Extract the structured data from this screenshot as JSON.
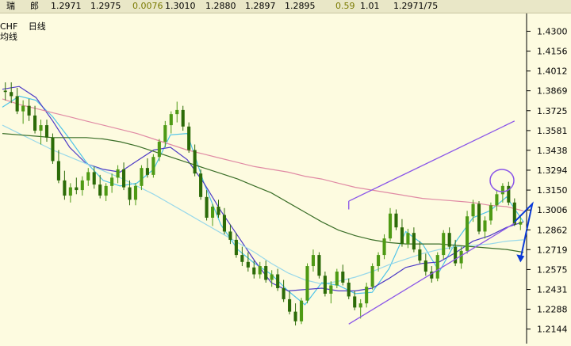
{
  "quote_bar": {
    "symbol_fragment": "瑞",
    "label": "郎",
    "values": [
      "1.2971",
      "1.2975",
      "0.0076",
      "1.3010",
      "1.2880",
      "1.2897",
      "1.2895",
      "0.59",
      "1.01",
      "1.2971/75"
    ]
  },
  "chart_header": {
    "pair_fragment": "CHF",
    "period": "日线",
    "indicator_fragment": "均线"
  },
  "colors": {
    "background": "#fdfbe0",
    "up_candle": "#4e9a14",
    "down_candle": "#2c6b08",
    "ma_fast": "#4fc4e8",
    "ma_mid": "#4d3bc6",
    "ma_slow_dark": "#3a6e28",
    "ma_slow_pink": "#e08aa4",
    "ma_slow_light": "#98d8ea",
    "channel": "#8a55e8",
    "forecast_arrow": "#0a3ad8",
    "highlight": "#7a7a00"
  },
  "chart_data": {
    "type": "candlestick",
    "title": "",
    "y_axis_side": "right",
    "ylim": [
      1.205,
      1.44
    ],
    "y_ticks": [
      "1.4300",
      "1.4156",
      "1.4012",
      "1.3869",
      "1.3725",
      "1.3581",
      "1.3438",
      "1.3294",
      "1.3150",
      "1.3006",
      "1.2862",
      "1.2719",
      "1.2575",
      "1.2431",
      "1.2288",
      "1.2144"
    ],
    "grid": false,
    "candles": [
      [
        1.387,
        1.393,
        1.38,
        1.386
      ],
      [
        1.386,
        1.393,
        1.378,
        1.383
      ],
      [
        1.383,
        1.389,
        1.37,
        1.372
      ],
      [
        1.372,
        1.38,
        1.363,
        1.376
      ],
      [
        1.376,
        1.381,
        1.365,
        1.369
      ],
      [
        1.369,
        1.376,
        1.356,
        1.358
      ],
      [
        1.358,
        1.366,
        1.348,
        1.362
      ],
      [
        1.362,
        1.366,
        1.35,
        1.353
      ],
      [
        1.353,
        1.356,
        1.334,
        1.336
      ],
      [
        1.336,
        1.344,
        1.32,
        1.322
      ],
      [
        1.322,
        1.329,
        1.308,
        1.311
      ],
      [
        1.311,
        1.32,
        1.306,
        1.317
      ],
      [
        1.317,
        1.324,
        1.312,
        1.315
      ],
      [
        1.315,
        1.325,
        1.311,
        1.322
      ],
      [
        1.322,
        1.331,
        1.318,
        1.328
      ],
      [
        1.328,
        1.332,
        1.316,
        1.319
      ],
      [
        1.319,
        1.326,
        1.309,
        1.311
      ],
      [
        1.311,
        1.32,
        1.307,
        1.318
      ],
      [
        1.318,
        1.327,
        1.313,
        1.324
      ],
      [
        1.324,
        1.333,
        1.32,
        1.33
      ],
      [
        1.33,
        1.335,
        1.315,
        1.317
      ],
      [
        1.317,
        1.322,
        1.304,
        1.308
      ],
      [
        1.308,
        1.32,
        1.304,
        1.318
      ],
      [
        1.318,
        1.333,
        1.315,
        1.331
      ],
      [
        1.331,
        1.338,
        1.324,
        1.326
      ],
      [
        1.326,
        1.341,
        1.324,
        1.339
      ],
      [
        1.339,
        1.352,
        1.336,
        1.35
      ],
      [
        1.35,
        1.365,
        1.346,
        1.362
      ],
      [
        1.362,
        1.372,
        1.356,
        1.37
      ],
      [
        1.37,
        1.379,
        1.364,
        1.373
      ],
      [
        1.373,
        1.376,
        1.358,
        1.361
      ],
      [
        1.361,
        1.364,
        1.342,
        1.344
      ],
      [
        1.344,
        1.348,
        1.325,
        1.327
      ],
      [
        1.327,
        1.33,
        1.308,
        1.31
      ],
      [
        1.31,
        1.315,
        1.293,
        1.295
      ],
      [
        1.295,
        1.305,
        1.289,
        1.303
      ],
      [
        1.303,
        1.308,
        1.295,
        1.297
      ],
      [
        1.297,
        1.302,
        1.283,
        1.285
      ],
      [
        1.285,
        1.29,
        1.276,
        1.279
      ],
      [
        1.279,
        1.284,
        1.266,
        1.268
      ],
      [
        1.268,
        1.274,
        1.26,
        1.263
      ],
      [
        1.263,
        1.27,
        1.256,
        1.259
      ],
      [
        1.259,
        1.264,
        1.251,
        1.254
      ],
      [
        1.254,
        1.263,
        1.251,
        1.26
      ],
      [
        1.26,
        1.264,
        1.248,
        1.25
      ],
      [
        1.25,
        1.257,
        1.245,
        1.254
      ],
      [
        1.254,
        1.258,
        1.242,
        1.244
      ],
      [
        1.244,
        1.25,
        1.234,
        1.236
      ],
      [
        1.236,
        1.242,
        1.225,
        1.227
      ],
      [
        1.227,
        1.233,
        1.217,
        1.22
      ],
      [
        1.22,
        1.237,
        1.218,
        1.235
      ],
      [
        1.235,
        1.262,
        1.233,
        1.26
      ],
      [
        1.26,
        1.272,
        1.256,
        1.268
      ],
      [
        1.268,
        1.27,
        1.251,
        1.253
      ],
      [
        1.253,
        1.256,
        1.238,
        1.24
      ],
      [
        1.24,
        1.249,
        1.233,
        1.246
      ],
      [
        1.246,
        1.258,
        1.244,
        1.256
      ],
      [
        1.256,
        1.261,
        1.246,
        1.248
      ],
      [
        1.248,
        1.251,
        1.236,
        1.238
      ],
      [
        1.238,
        1.242,
        1.228,
        1.23
      ],
      [
        1.23,
        1.236,
        1.222,
        1.233
      ],
      [
        1.233,
        1.248,
        1.23,
        1.245
      ],
      [
        1.245,
        1.262,
        1.243,
        1.26
      ],
      [
        1.26,
        1.27,
        1.256,
        1.268
      ],
      [
        1.268,
        1.283,
        1.265,
        1.28
      ],
      [
        1.28,
        1.302,
        1.278,
        1.298
      ],
      [
        1.298,
        1.301,
        1.286,
        1.288
      ],
      [
        1.288,
        1.294,
        1.274,
        1.276
      ],
      [
        1.276,
        1.287,
        1.273,
        1.284
      ],
      [
        1.284,
        1.288,
        1.27,
        1.272
      ],
      [
        1.272,
        1.278,
        1.262,
        1.264
      ],
      [
        1.264,
        1.269,
        1.253,
        1.256
      ],
      [
        1.256,
        1.26,
        1.248,
        1.251
      ],
      [
        1.251,
        1.27,
        1.249,
        1.268
      ],
      [
        1.268,
        1.286,
        1.265,
        1.284
      ],
      [
        1.284,
        1.288,
        1.272,
        1.274
      ],
      [
        1.274,
        1.279,
        1.26,
        1.262
      ],
      [
        1.262,
        1.274,
        1.258,
        1.271
      ],
      [
        1.271,
        1.3,
        1.269,
        1.296
      ],
      [
        1.296,
        1.308,
        1.292,
        1.305
      ],
      [
        1.305,
        1.307,
        1.283,
        1.285
      ],
      [
        1.285,
        1.296,
        1.28,
        1.293
      ],
      [
        1.293,
        1.306,
        1.29,
        1.304
      ],
      [
        1.304,
        1.315,
        1.3,
        1.312
      ],
      [
        1.312,
        1.32,
        1.306,
        1.318
      ],
      [
        1.318,
        1.321,
        1.304,
        1.306
      ],
      [
        1.306,
        1.309,
        1.289,
        1.29
      ],
      [
        1.29,
        1.296,
        1.286,
        1.292
      ]
    ],
    "moving_averages": [
      {
        "color_key": "ma_fast",
        "values": [
          1.375,
          1.383,
          1.38,
          1.368,
          1.352,
          1.335,
          1.322,
          1.318,
          1.32,
          1.33,
          1.355,
          1.356,
          1.32,
          1.29,
          1.272,
          1.262,
          1.254,
          1.242,
          1.232,
          1.248,
          1.246,
          1.24,
          1.241,
          1.258,
          1.285,
          1.276,
          1.256,
          1.278,
          1.295,
          1.3,
          1.31,
          1.292
        ]
      },
      {
        "color_key": "ma_mid",
        "values": [
          1.388,
          1.39,
          1.382,
          1.365,
          1.346,
          1.334,
          1.33,
          1.328,
          1.336,
          1.344,
          1.346,
          1.337,
          1.32,
          1.3,
          1.282,
          1.264,
          1.248,
          1.242,
          1.243,
          1.244,
          1.242,
          1.242,
          1.244,
          1.251,
          1.259,
          1.262,
          1.263,
          1.27,
          1.278,
          1.282,
          1.288,
          1.292
        ]
      },
      {
        "color_key": "ma_slow_light",
        "values": [
          1.362,
          1.356,
          1.35,
          1.344,
          1.339,
          1.334,
          1.329,
          1.324,
          1.318,
          1.312,
          1.305,
          1.298,
          1.291,
          1.284,
          1.277,
          1.27,
          1.262,
          1.255,
          1.25,
          1.247,
          1.249,
          1.252,
          1.256,
          1.261,
          1.265,
          1.269,
          1.272,
          1.274,
          1.275,
          1.276,
          1.278,
          1.279
        ]
      },
      {
        "color_key": "ma_slow_dark",
        "values": [
          1.356,
          1.355,
          1.354,
          1.353,
          1.353,
          1.353,
          1.352,
          1.35,
          1.347,
          1.343,
          1.339,
          1.335,
          1.331,
          1.327,
          1.323,
          1.318,
          1.313,
          1.306,
          1.299,
          1.292,
          1.286,
          1.282,
          1.279,
          1.277,
          1.276,
          1.276,
          1.276,
          1.275,
          1.274,
          1.273,
          1.272,
          1.27
        ]
      },
      {
        "color_key": "ma_slow_pink",
        "values": [
          1.381,
          1.377,
          1.374,
          1.371,
          1.368,
          1.365,
          1.362,
          1.359,
          1.356,
          1.352,
          1.348,
          1.344,
          1.341,
          1.338,
          1.335,
          1.332,
          1.33,
          1.328,
          1.325,
          1.323,
          1.32,
          1.317,
          1.315,
          1.313,
          1.311,
          1.309,
          1.308,
          1.307,
          1.306,
          1.304,
          1.303,
          1.3
        ]
      }
    ],
    "trend_channel": {
      "upper": [
        [
          58,
          1.307
        ],
        [
          86,
          1.365
        ]
      ],
      "lower": [
        [
          58,
          1.218
        ],
        [
          86,
          1.291
        ]
      ]
    },
    "forecast_arrow": [
      [
        86,
        1.292
      ],
      [
        89,
        1.305
      ],
      [
        87,
        1.265
      ]
    ]
  }
}
